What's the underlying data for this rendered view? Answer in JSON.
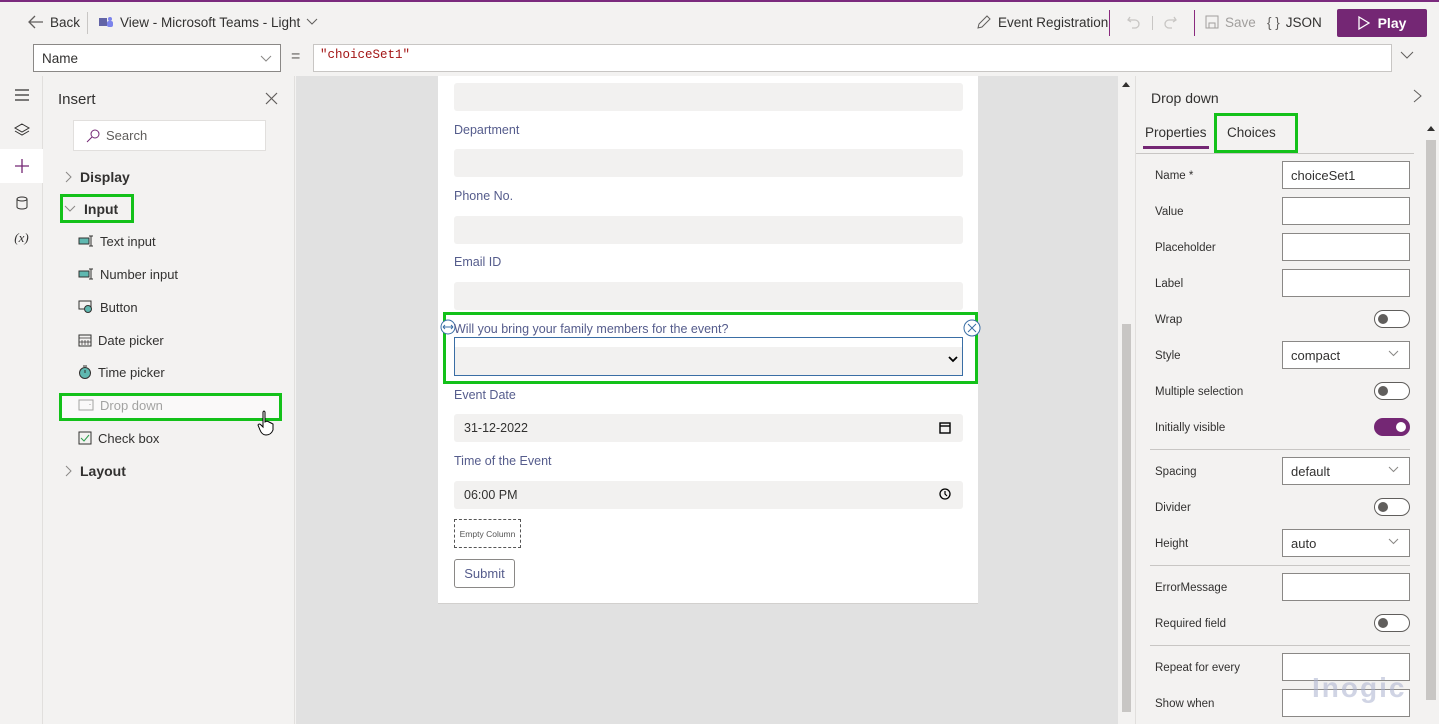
{
  "topbar": {
    "back_label": "Back",
    "view_label": "View - Microsoft Teams - Light",
    "app_name": "Event Registration",
    "save_label": "Save",
    "json_label": "JSON",
    "play_label": "Play",
    "accent_color": "#742774"
  },
  "formula_bar": {
    "property": "Name",
    "equals": "=",
    "formula": "\"choiceSet1\""
  },
  "insert_pane": {
    "title": "Insert",
    "search_placeholder": "Search",
    "groups": [
      {
        "label": "Display",
        "expanded": false
      },
      {
        "label": "Input",
        "expanded": true,
        "items": [
          {
            "label": "Text input",
            "icon": "text-input-icon"
          },
          {
            "label": "Number input",
            "icon": "number-input-icon"
          },
          {
            "label": "Button",
            "icon": "button-icon"
          },
          {
            "label": "Date picker",
            "icon": "calendar-icon"
          },
          {
            "label": "Time picker",
            "icon": "timer-icon"
          },
          {
            "label": "Drop down",
            "icon": "dropdown-icon"
          },
          {
            "label": "Check box",
            "icon": "checkbox-icon"
          }
        ]
      },
      {
        "label": "Layout",
        "expanded": false
      }
    ]
  },
  "form": {
    "fields": [
      {
        "label": "Department",
        "value": ""
      },
      {
        "label": "Phone No.",
        "value": ""
      },
      {
        "label": "Email ID",
        "value": ""
      }
    ],
    "dropdown_label": "Will you bring your family members for the event?",
    "event_date_label": "Event Date",
    "event_date_value": "31-12-2022",
    "event_time_label": "Time of the Event",
    "event_time_value": "06:00 PM",
    "empty_column": "Empty Column",
    "submit_label": "Submit"
  },
  "properties_pane": {
    "title": "Drop down",
    "tabs": [
      {
        "label": "Properties",
        "active": true
      },
      {
        "label": "Choices",
        "active": false
      }
    ],
    "rows": {
      "name": {
        "label": "Name *",
        "value": "choiceSet1"
      },
      "value": {
        "label": "Value",
        "value": ""
      },
      "placeholder": {
        "label": "Placeholder",
        "value": ""
      },
      "label": {
        "label": "Label",
        "value": ""
      },
      "wrap": {
        "label": "Wrap",
        "on": false
      },
      "style": {
        "label": "Style",
        "value": "compact"
      },
      "multiple": {
        "label": "Multiple selection",
        "on": false
      },
      "visible": {
        "label": "Initially visible",
        "on": true
      },
      "spacing": {
        "label": "Spacing",
        "value": "default"
      },
      "divider": {
        "label": "Divider",
        "on": false
      },
      "height": {
        "label": "Height",
        "value": "auto"
      },
      "error": {
        "label": "ErrorMessage",
        "value": ""
      },
      "required": {
        "label": "Required field",
        "on": false
      },
      "repeat": {
        "label": "Repeat for every",
        "value": ""
      },
      "show_when": {
        "label": "Show when",
        "value": ""
      }
    }
  },
  "watermark": "Inogic"
}
